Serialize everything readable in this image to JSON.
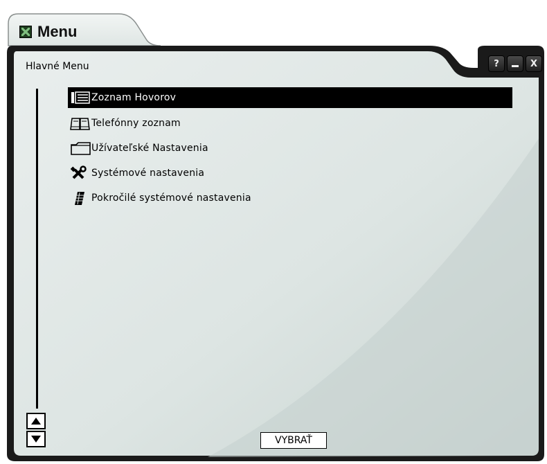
{
  "window": {
    "tab_title": "Menu",
    "panel_title": "Hlavné Menu",
    "buttons": {
      "help": "?",
      "close": "X"
    }
  },
  "menu": {
    "items": [
      {
        "label": "Zoznam Hovorov",
        "icon": "call-list-icon",
        "selected": true
      },
      {
        "label": "Telefónny zoznam",
        "icon": "phonebook-icon",
        "selected": false
      },
      {
        "label": "Užívateľské Nastavenia",
        "icon": "folder-icon",
        "selected": false
      },
      {
        "label": "Systémové nastavenia",
        "icon": "tools-icon",
        "selected": false
      },
      {
        "label": "Pokročilé systémové nastavenia",
        "icon": "keypad-icon",
        "selected": false
      }
    ]
  },
  "footer": {
    "select_label": "VYBRAŤ"
  },
  "colors": {
    "panel_bg": "#dfe6e4",
    "selection_bg": "#000000",
    "frame": "#1a1a1a"
  }
}
